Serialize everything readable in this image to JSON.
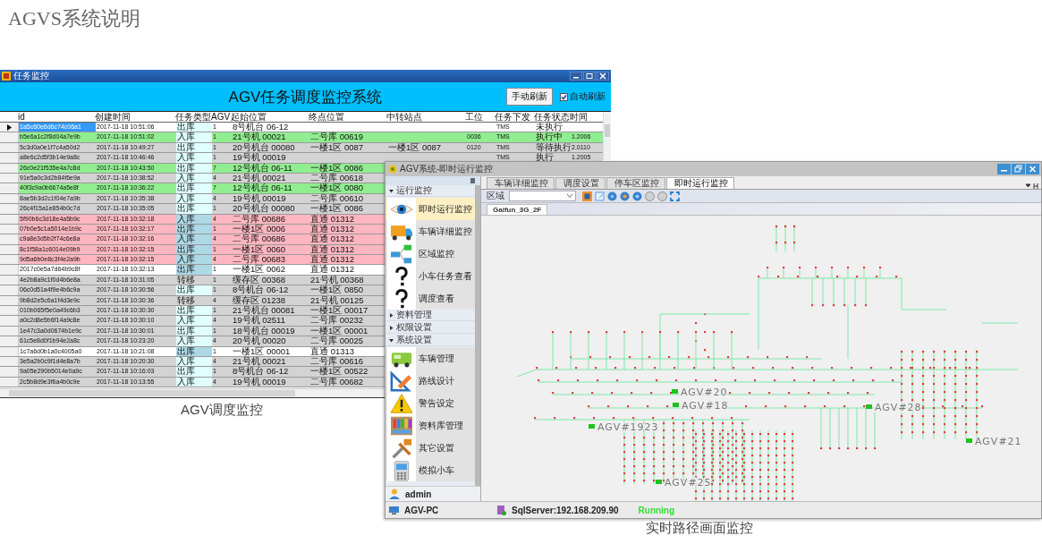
{
  "page": {
    "title": "AGVS系统说明"
  },
  "dispatch_window": {
    "title": "任务监控",
    "header": "AGV任务调度监控系统",
    "refresh_button": "手动刷新",
    "auto_refresh": {
      "label": "自动刷新",
      "checked": true
    },
    "table": {
      "columns": [
        "id",
        "创建时间",
        "任务类型",
        "AGV",
        "起始位置",
        "终点位置",
        "中转站点",
        "工位",
        "任务下发",
        "任务状态",
        "时间"
      ],
      "rows": [
        {
          "selected": true,
          "color": "#ffffff",
          "cells": [
            "1a5c60e6d6c74c06a1",
            {
              "text": "2017-11-18 10:51:06"
            },
            {
              "text": "出库",
              "color": "#e0ffff"
            },
            "1",
            "8号机台 06-12",
            "",
            "",
            "",
            "TMS",
            "未执行",
            ""
          ]
        },
        {
          "selected": false,
          "color": "#90ee90",
          "cells": [
            "b5e6a1c2f8d04a7e9b",
            {
              "text": "2017-11-18 10:51:02"
            },
            {
              "text": "入库",
              "color": "#e0ffff"
            },
            "1",
            "21号机 00021",
            "二号库 00619",
            "",
            "0036",
            "TMS",
            "执行中",
            "1.2006"
          ]
        },
        {
          "selected": false,
          "color": "#d3d3d3",
          "cells": [
            "5c3d0a0e1f7c4a50d2",
            {
              "text": "2017-11-18 10:49:27"
            },
            {
              "text": "出库",
              "color": "#e0ffff"
            },
            "1",
            "20号机台 00080",
            "一楼1区 0087",
            "一楼1区 0087",
            "0120",
            "TMS",
            "等待执行",
            "2.0110"
          ]
        },
        {
          "selected": false,
          "color": "#d3d3d3",
          "cells": [
            "a8e6c2d5f3b14e9a8c",
            {
              "text": "2017-11-18 10:46:46"
            },
            {
              "text": "入库",
              "color": "#e0ffff"
            },
            "1",
            "19号机 00019",
            "",
            "",
            "",
            "TMS",
            "执行",
            "1.2005"
          ]
        },
        {
          "selected": false,
          "color": "#90ee90",
          "cells": [
            "26c0e21f535e4a7c8d",
            {
              "text": "2017-11-18 10:43:50"
            },
            {
              "text": "出库",
              "color": "#e0ffff"
            },
            "7",
            "12号机台 06-11",
            "一楼1区 0086"
          ]
        },
        {
          "selected": false,
          "color": "#d3d3d3",
          "cells": [
            "91e5a0c3d2b84f6e9a",
            {
              "text": "2017-11-18 10:38:52"
            },
            {
              "text": "入库",
              "color": "#e0ffff"
            },
            "4",
            "21号机 00021",
            "二号库 00618"
          ]
        },
        {
          "selected": false,
          "color": "#90ee90",
          "cells": [
            "40f3c9a0b6674a5e8f",
            {
              "text": "2017-11-18 10:36:22"
            },
            {
              "text": "出库",
              "color": "#e0ffff"
            },
            "7",
            "12号机台 06-11",
            "一楼1区 0080"
          ]
        },
        {
          "selected": false,
          "color": "#d3d3d3",
          "cells": [
            "8ae5b3d2c1f04e7a9b",
            {
              "text": "2017-11-18 10:35:38"
            },
            {
              "text": "入库",
              "color": "#e0ffff"
            },
            "4",
            "19号机 00019",
            "二号库 00610"
          ]
        },
        {
          "selected": false,
          "color": "#d3d3d3",
          "cells": [
            "26c4f15a1e854b0c7d",
            {
              "text": "2017-11-18 10:35:05"
            },
            {
              "text": "出库",
              "color": "#e0ffff"
            },
            "1",
            "20号机台 00080",
            "一楼1区 0086"
          ]
        },
        {
          "selected": false,
          "color": "#ffb6c1",
          "cells": [
            "5f90b6c3d18e4a5b9c",
            {
              "text": "2017-11-18 10:32:18"
            },
            {
              "text": "入库",
              "color": "#add8e6"
            },
            "4",
            "二号库 00686",
            "直通 01312"
          ]
        },
        {
          "selected": false,
          "color": "#ffb6c1",
          "cells": [
            "07b0e5c1a5014e1b9c",
            {
              "text": "2017-11-18 10:32:17"
            },
            {
              "text": "出库",
              "color": "#add8e6"
            },
            "1",
            "一楼1区 0006",
            "直通 01312"
          ]
        },
        {
          "selected": false,
          "color": "#ffb6c1",
          "cells": [
            "c9a8e3d5b2f74c6e8a",
            {
              "text": "2017-11-18 10:32:16"
            },
            {
              "text": "入库",
              "color": "#add8e6"
            },
            "4",
            "二号库 00686",
            "直通 01312"
          ]
        },
        {
          "selected": false,
          "color": "#ffb6c1",
          "cells": [
            "8c1f58a1c6014e09b9",
            {
              "text": "2017-11-18 10:32:15"
            },
            {
              "text": "出库",
              "color": "#add8e6"
            },
            "1",
            "一楼1区 0060",
            "直通 01312"
          ]
        },
        {
          "selected": false,
          "color": "#ffb6c1",
          "cells": [
            "9d5a6b0e8c3f4e2a9b",
            {
              "text": "2017-11-18 10:32:15"
            },
            {
              "text": "入库",
              "color": "#add8e6"
            },
            "4",
            "二号库 00683",
            "直通 01312"
          ]
        },
        {
          "selected": false,
          "color": "#ffffff",
          "cells": [
            "2017c0e5a7d64b9c8f",
            {
              "text": "2017-11-18 10:32:13"
            },
            {
              "text": "出库",
              "color": "#add8e6"
            },
            "1",
            "一楼1区 0062",
            "直通 01312"
          ]
        },
        {
          "selected": false,
          "color": "#d3d3d3",
          "cells": [
            "4e2b8a9c1f0d4b6e8a",
            {
              "text": "2017-11-18 10:31:05"
            },
            {
              "text": "转移",
              "color": "#d3d3d3"
            },
            "1",
            "缓存区 00368",
            "21号机 00368"
          ]
        },
        {
          "selected": false,
          "color": "#d3d3d3",
          "cells": [
            "06c0d51a4f9e4b6c9a",
            {
              "text": "2017-11-18 10:30:56"
            },
            {
              "text": "出库",
              "color": "#e0ffff"
            },
            "1",
            "8号机台 06-12",
            "一楼1区 0850"
          ]
        },
        {
          "selected": false,
          "color": "#d3d3d3",
          "cells": [
            "9b8d2e5c6a1f4d3e9c",
            {
              "text": "2017-11-18 10:30:36"
            },
            {
              "text": "转移",
              "color": "#d3d3d3"
            },
            "4",
            "缓存区 01238",
            "21号机 00125"
          ]
        },
        {
          "selected": false,
          "color": "#d3d3d3",
          "cells": [
            "010b065f5e0a49c6b3",
            {
              "text": "2017-11-18 10:30:30"
            },
            {
              "text": "出库",
              "color": "#e0ffff"
            },
            "1",
            "21号机台 00081",
            "一楼1区 00017"
          ]
        },
        {
          "selected": false,
          "color": "#d3d3d3",
          "cells": [
            "a0c2d8e5b6f14a9c8e",
            {
              "text": "2017-11-18 10:30:10"
            },
            {
              "text": "入库",
              "color": "#e0ffff"
            },
            "4",
            "19号机 02511",
            "二号库 00232"
          ]
        },
        {
          "selected": false,
          "color": "#d3d3d3",
          "cells": [
            "1e47c3a0d0674b1e9c",
            {
              "text": "2017-11-18 10:30:01"
            },
            {
              "text": "出库",
              "color": "#e0ffff"
            },
            "1",
            "18号机台 00019",
            "一楼1区 00001"
          ]
        },
        {
          "selected": false,
          "color": "#d3d3d3",
          "cells": [
            "61c5e8d0f1b94e2a8c",
            {
              "text": "2017-11-18 10:23:20"
            },
            {
              "text": "入库",
              "color": "#e0ffff"
            },
            "4",
            "20号机 00020",
            "二号库 00025"
          ]
        },
        {
          "selected": false,
          "color": "#ffffff",
          "cells": [
            "1c7a6d0b1a0c4005a0",
            {
              "text": "2017-11-18 10:21:08"
            },
            {
              "text": "出库",
              "color": "#add8e6"
            },
            "1",
            "一楼1区 00001",
            "直通 01313"
          ]
        },
        {
          "selected": false,
          "color": "#d3d3d3",
          "cells": [
            "3e5a2b0c9f1d4e8a7b",
            {
              "text": "2017-11-18 10:20:30"
            },
            {
              "text": "入库",
              "color": "#e0ffff"
            },
            "4",
            "21号机 00021",
            "二号库 00616"
          ]
        },
        {
          "selected": false,
          "color": "#d3d3d3",
          "cells": [
            "9a05e290b5014e0a9c",
            {
              "text": "2017-11-18 10:16:03"
            },
            {
              "text": "出库",
              "color": "#e0ffff"
            },
            "1",
            "8号机台 06-12",
            "一楼1区 00522"
          ]
        },
        {
          "selected": false,
          "color": "#d3d3d3",
          "cells": [
            "2c5b8d9e3f6a4b0c9e",
            {
              "text": "2017-11-18 10:13:55"
            },
            {
              "text": "入库",
              "color": "#e0ffff"
            },
            "4",
            "19号机 00019",
            "二号库 00682"
          ]
        }
      ]
    }
  },
  "monitor_window": {
    "title": "AGV系统-即时运行监控",
    "sidebar": {
      "groups": [
        {
          "label": "运行监控",
          "expanded": true,
          "items": [
            {
              "label": "即时运行监控",
              "selected": true
            },
            {
              "label": "车辆详细监控",
              "selected": false
            },
            {
              "label": "区域监控",
              "selected": false
            },
            {
              "label": "小车任务查看",
              "selected": false
            },
            {
              "label": "调度查看",
              "selected": false
            }
          ]
        },
        {
          "label": "资料管理",
          "expanded": false
        },
        {
          "label": "权限设置",
          "expanded": false
        },
        {
          "label": "系统设置",
          "expanded": true,
          "items": [
            {
              "label": "车辆管理",
              "selected": false
            },
            {
              "label": "路线设计",
              "selected": false
            },
            {
              "label": "警告设定",
              "selected": false
            },
            {
              "label": "资料库管理",
              "selected": false
            },
            {
              "label": "其它设置",
              "selected": false
            },
            {
              "label": "模拟小车",
              "selected": false
            }
          ]
        }
      ],
      "user": "admin"
    },
    "tabs": [
      {
        "label": "车辆详细监控",
        "selected": false
      },
      {
        "label": "调度设置",
        "selected": false
      },
      {
        "label": "停车区监控",
        "selected": false
      },
      {
        "label": "即时运行监控",
        "selected": true
      }
    ],
    "toolbar": {
      "area_label": "区域"
    },
    "map_tab": "Gaifun_3G_2F",
    "agv_labels": [
      "AGV#20",
      "AGV#18",
      "AGV#1923",
      "AGV#28",
      "AGV#21",
      "AGV#25"
    ],
    "status_bar": {
      "machine": "AGV-PC",
      "server": "SqlServer:192.168.209.90",
      "state": "Running"
    }
  },
  "captions": [
    "AGV调度监控",
    "实时路径画面监控"
  ]
}
